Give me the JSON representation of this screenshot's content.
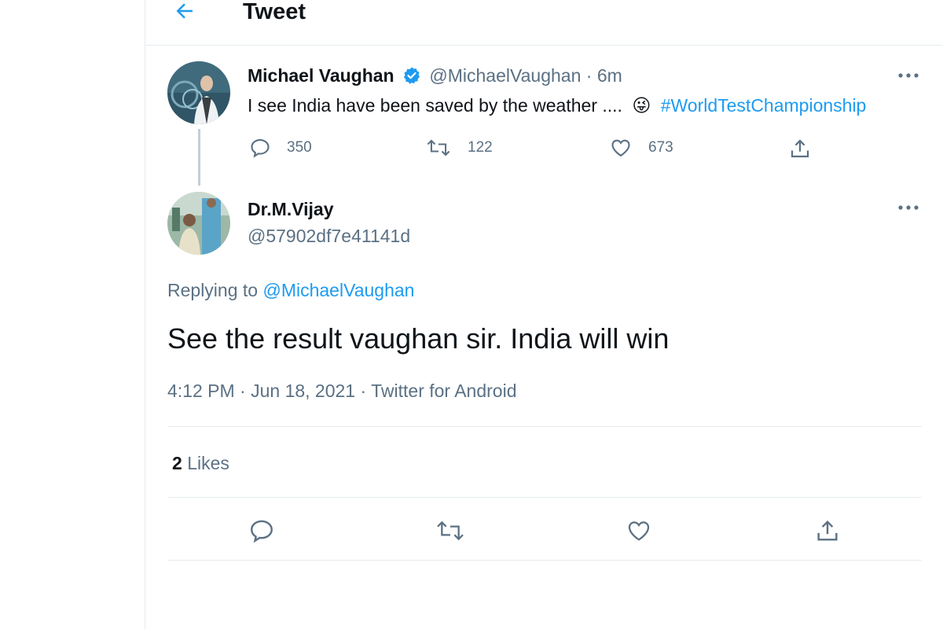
{
  "header": {
    "title": "Tweet"
  },
  "parent_tweet": {
    "display_name": "Michael Vaughan",
    "handle_time": "@MichaelVaughan · 6m",
    "text": "I see India have been saved by the weather ....",
    "emoji": "😜",
    "hashtag": "#WorldTestChampionship",
    "replies": "350",
    "retweets": "122",
    "likes": "673"
  },
  "main_tweet": {
    "display_name": "Dr.M.Vijay",
    "handle": "@57902df7e41141d",
    "replying_label": "Replying to",
    "replying_handle": "@MichaelVaughan",
    "text": "See the result vaughan sir. India will win",
    "meta": "4:12 PM · Jun 18, 2021 · Twitter for Android",
    "likes_count": "2",
    "likes_label": "Likes"
  },
  "colors": {
    "accent": "#1d9bf0",
    "muted": "#5b7083",
    "divider": "#e6ecf0",
    "verified": "#1d9bf0"
  },
  "icons": {
    "back": "arrow-left-icon",
    "verified": "verified-badge-icon",
    "more": "more-horizontal-icon",
    "reply": "reply-icon",
    "retweet": "retweet-icon",
    "like": "heart-icon",
    "share": "share-icon"
  }
}
